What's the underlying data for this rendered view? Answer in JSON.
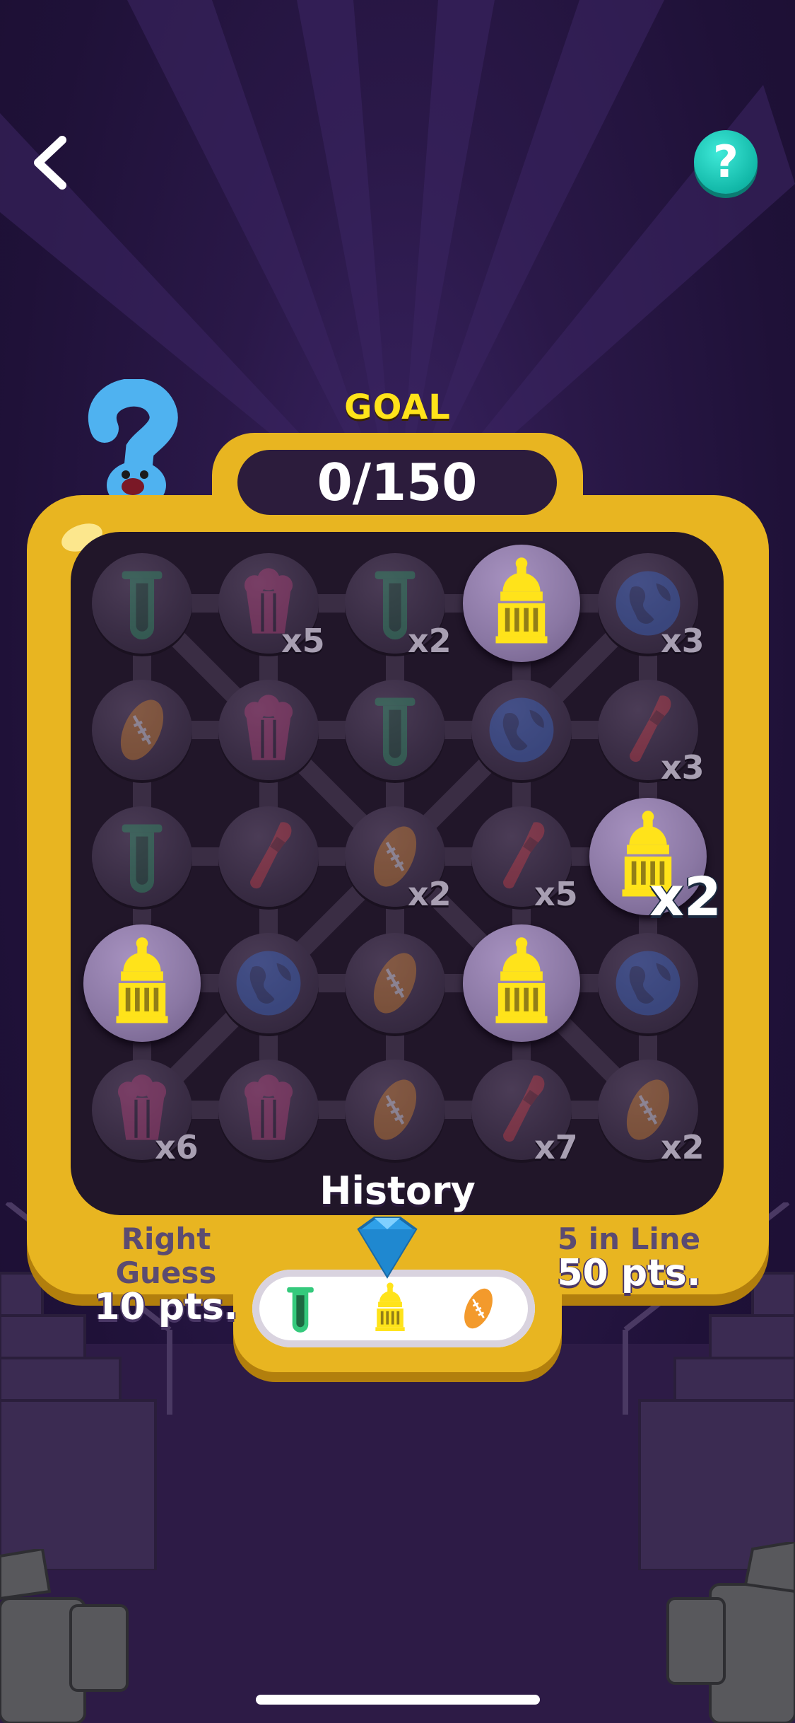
{
  "header": {
    "back_icon": "chevron-left-icon",
    "help_icon": "question-mark-icon",
    "help_label": "?"
  },
  "goal": {
    "label": "GOAL",
    "score": "0/150"
  },
  "board": {
    "rows": [
      [
        {
          "icon": "test-tube-icon",
          "color": "#2ea36a",
          "active": false,
          "mult": ""
        },
        {
          "icon": "popcorn-icon",
          "color": "#c2437f",
          "active": false,
          "mult": "x5"
        },
        {
          "icon": "test-tube-icon",
          "color": "#2ea36a",
          "active": false,
          "mult": "x2"
        },
        {
          "icon": "capitol-icon",
          "color": "#ffe31a",
          "active": true,
          "mult": ""
        },
        {
          "icon": "globe-icon",
          "color": "#3a6fd6",
          "active": false,
          "mult": "x3"
        }
      ],
      [
        {
          "icon": "football-icon",
          "color": "#e08a2a",
          "active": false,
          "mult": ""
        },
        {
          "icon": "popcorn-icon",
          "color": "#c2437f",
          "active": false,
          "mult": ""
        },
        {
          "icon": "test-tube-icon",
          "color": "#2ea36a",
          "active": false,
          "mult": ""
        },
        {
          "icon": "globe-icon",
          "color": "#3a6fd6",
          "active": false,
          "mult": ""
        },
        {
          "icon": "paintbrush-icon",
          "color": "#d94048",
          "active": false,
          "mult": "x3"
        }
      ],
      [
        {
          "icon": "test-tube-icon",
          "color": "#2ea36a",
          "active": false,
          "mult": ""
        },
        {
          "icon": "paintbrush-icon",
          "color": "#d94048",
          "active": false,
          "mult": ""
        },
        {
          "icon": "football-icon",
          "color": "#e08a2a",
          "active": false,
          "mult": "x2"
        },
        {
          "icon": "paintbrush-icon",
          "color": "#d94048",
          "active": false,
          "mult": "x5"
        },
        {
          "icon": "capitol-icon",
          "color": "#ffe31a",
          "active": true,
          "mult": "x2"
        }
      ],
      [
        {
          "icon": "capitol-icon",
          "color": "#ffe31a",
          "active": true,
          "mult": ""
        },
        {
          "icon": "globe-icon",
          "color": "#3a6fd6",
          "active": false,
          "mult": ""
        },
        {
          "icon": "football-icon",
          "color": "#e08a2a",
          "active": false,
          "mult": ""
        },
        {
          "icon": "capitol-icon",
          "color": "#ffe31a",
          "active": true,
          "mult": ""
        },
        {
          "icon": "globe-icon",
          "color": "#3a6fd6",
          "active": false,
          "mult": ""
        }
      ],
      [
        {
          "icon": "popcorn-icon",
          "color": "#c2437f",
          "active": false,
          "mult": "x6"
        },
        {
          "icon": "popcorn-icon",
          "color": "#c2437f",
          "active": false,
          "mult": ""
        },
        {
          "icon": "football-icon",
          "color": "#e08a2a",
          "active": false,
          "mult": ""
        },
        {
          "icon": "paintbrush-icon",
          "color": "#d94048",
          "active": false,
          "mult": "x7"
        },
        {
          "icon": "football-icon",
          "color": "#e08a2a",
          "active": false,
          "mult": "x2"
        }
      ]
    ]
  },
  "history": {
    "label": "History",
    "items": [
      {
        "icon": "test-tube-icon",
        "color": "#35c97c"
      },
      {
        "icon": "capitol-icon",
        "color": "#ffe31a"
      },
      {
        "icon": "football-icon",
        "color": "#f39a2c"
      }
    ],
    "pointer_icon": "blue-gem-icon"
  },
  "scoring": {
    "left_title": "Right Guess",
    "left_points": "10 pts.",
    "right_title": "5 in Line",
    "right_points": "50 pts."
  },
  "colors": {
    "frame": "#e8b521",
    "board": "#211629",
    "accent_goal": "#ffe31a",
    "help_button": "#12b8a8"
  }
}
